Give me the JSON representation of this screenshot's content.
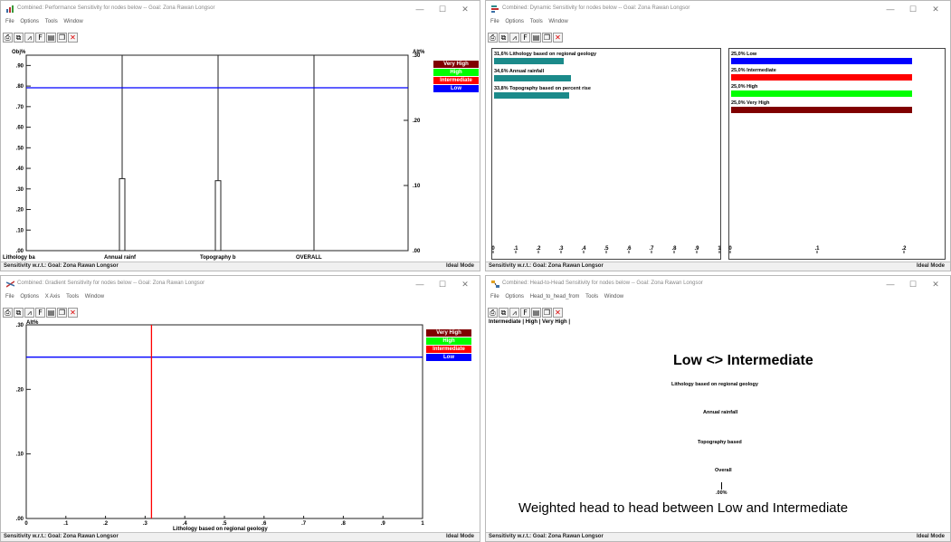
{
  "windows": {
    "performance": {
      "title": "Combined: Performance Sensitivity for nodes below -- Goal: Zona Rawan Longsor",
      "menu": [
        "File",
        "Options",
        "Tools",
        "Window"
      ],
      "left_axis_label": "Obj%",
      "right_axis_label": "Alt%",
      "left_ticks": [
        ".00",
        ".10",
        ".20",
        ".30",
        ".40",
        ".50",
        ".60",
        ".70",
        ".80",
        ".90"
      ],
      "right_ticks": [
        ".00",
        ".10",
        ".20",
        ".30"
      ],
      "categories": [
        "Lithology ba",
        "Annual rainf",
        "Topography b",
        "OVERALL"
      ],
      "status_left": "Sensitivity w.r.t.: Goal: Zona Rawan Longsor",
      "status_right": "Ideal Mode"
    },
    "dynamic": {
      "title": "Combined: Dynamic Sensitivity for nodes below -- Goal: Zona Rawan Longsor",
      "menu": [
        "File",
        "Options",
        "Tools",
        "Window"
      ],
      "left_ticks": [
        "0",
        ".1",
        ".2",
        ".3",
        ".4",
        ".5",
        ".6",
        ".7",
        ".8",
        ".9",
        "1"
      ],
      "right_ticks": [
        "0",
        ".1",
        ".2"
      ],
      "status_left": "Sensitivity w.r.t.: Goal: Zona Rawan Longsor",
      "status_right": "Ideal Mode"
    },
    "gradient": {
      "title": "Combined: Gradient Sensitivity for nodes below -- Goal: Zona Rawan Longsor",
      "menu": [
        "File",
        "Options",
        "X Axis",
        "Tools",
        "Window"
      ],
      "y_axis_label": "Alt%",
      "y_ticks": [
        ".00",
        ".10",
        ".20",
        ".30"
      ],
      "x_ticks": [
        "0",
        ".1",
        ".2",
        ".3",
        ".4",
        ".5",
        ".6",
        ".7",
        ".8",
        ".9",
        "1"
      ],
      "x_label": "Lithology based on regional geology",
      "status_left": "Sensitivity w.r.t.: Goal: Zona Rawan Longsor",
      "status_right": "Ideal Mode"
    },
    "head_to_head": {
      "title": "Combined: Head-to-Head Sensitivity for nodes below -- Goal: Zona Rawan Longsor",
      "menu": [
        "File",
        "Options",
        "Head_to_head_from",
        "Tools",
        "Window"
      ],
      "tabs_text": "Intermediate | High | Very High |",
      "heading": "Low <> Intermediate",
      "items": [
        "Lithology based on regional geology",
        "Annual rainfall",
        "Topography based",
        "Overall"
      ],
      "zero_label": ".00%",
      "footer": "Weighted head to head between Low and Intermediate",
      "status_left": "Sensitivity w.r.t.: Goal: Zona Rawan Longsor",
      "status_right": "Ideal Mode"
    }
  },
  "legend": [
    {
      "label": "Very High",
      "color": "#800000"
    },
    {
      "label": "High",
      "color": "#00ff00"
    },
    {
      "label": "Intermediate",
      "color": "#ff0000"
    },
    {
      "label": "Low",
      "color": "#0000ff"
    }
  ],
  "criteria": [
    {
      "label": "31,6% Lithology based on regional geology",
      "value": 0.316
    },
    {
      "label": "34,6% Annual rainfall",
      "value": 0.346
    },
    {
      "label": "33,8% Topography based on percent rise",
      "value": 0.338
    }
  ],
  "alternatives": [
    {
      "label": "25,0% Low",
      "value": 0.25,
      "color": "#0000ff"
    },
    {
      "label": "25,0% Intermediate",
      "value": 0.25,
      "color": "#ff0000"
    },
    {
      "label": "25,0% High",
      "value": 0.25,
      "color": "#00ff00"
    },
    {
      "label": "25,0% Very High",
      "value": 0.25,
      "color": "#800000"
    }
  ],
  "chart_data": [
    {
      "type": "bar",
      "name_ref": "performance",
      "categories": [
        "Lithology ba",
        "Annual rainf",
        "Topography b",
        "OVERALL"
      ],
      "objective_values": [
        0.0,
        0.35,
        0.34,
        0.0
      ],
      "alternative_level": 0.25,
      "ylim_left": [
        0,
        0.95
      ],
      "ylim_right": [
        0,
        0.3
      ]
    },
    {
      "type": "line",
      "name_ref": "gradient",
      "x_value": 0.316,
      "alternative_level": 0.25,
      "xlim": [
        0,
        1
      ],
      "ylim": [
        0,
        0.3
      ]
    }
  ]
}
